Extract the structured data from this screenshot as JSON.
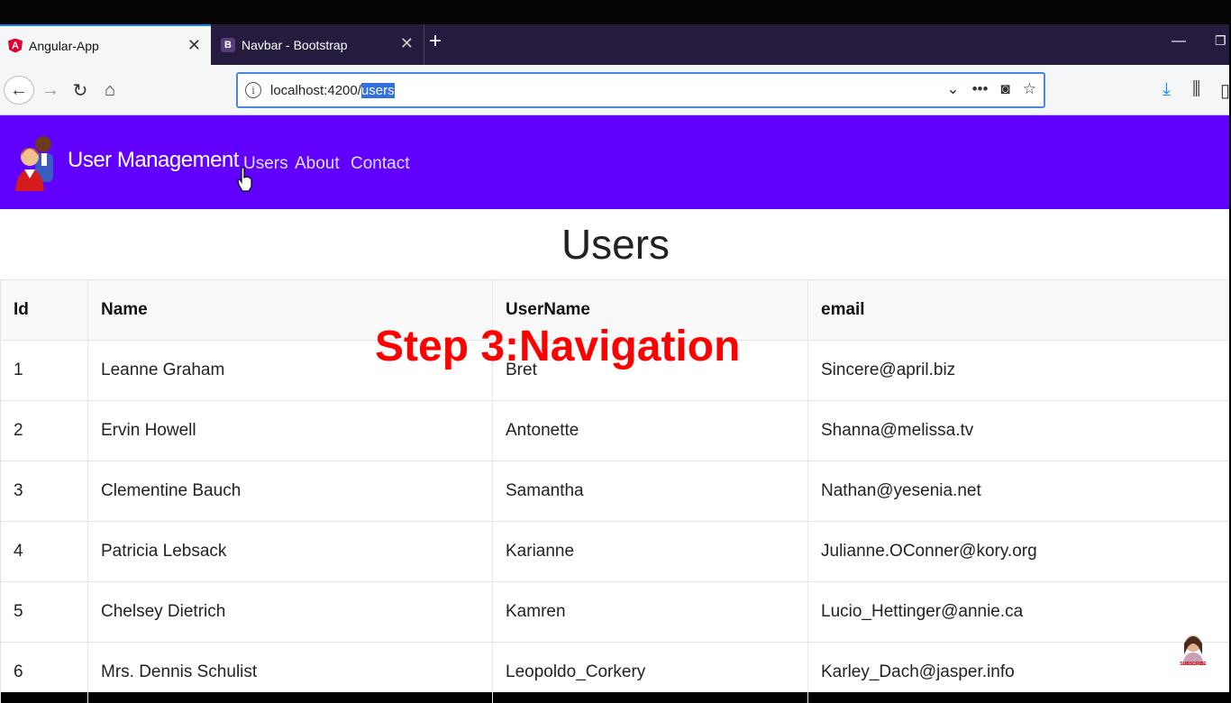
{
  "browser": {
    "tabs": [
      {
        "title": "Angular-App",
        "favicon": "angular-icon",
        "active": true
      },
      {
        "title": "Navbar - Bootstrap",
        "favicon": "bootstrap-icon",
        "active": false
      }
    ],
    "url_host": "localhost:4200/",
    "url_path": "users"
  },
  "app": {
    "brand": "User Management",
    "nav": [
      "Users",
      "About",
      "Contact"
    ],
    "colors": {
      "navbar": "#6200ff",
      "overlay": "#ff0000"
    }
  },
  "page": {
    "title": "Users",
    "columns": [
      "Id",
      "Name",
      "UserName",
      "email"
    ],
    "rows": [
      [
        "1",
        "Leanne Graham",
        "Bret",
        "Sincere@april.biz"
      ],
      [
        "2",
        "Ervin Howell",
        "Antonette",
        "Shanna@melissa.tv"
      ],
      [
        "3",
        "Clementine Bauch",
        "Samantha",
        "Nathan@yesenia.net"
      ],
      [
        "4",
        "Patricia Lebsack",
        "Karianne",
        "Julianne.OConner@kory.org"
      ],
      [
        "5",
        "Chelsey Dietrich",
        "Kamren",
        "Lucio_Hettinger@annie.ca"
      ],
      [
        "6",
        "Mrs. Dennis Schulist",
        "Leopoldo_Corkery",
        "Karley_Dach@jasper.info"
      ]
    ]
  },
  "overlay": {
    "text": "Step 3:Navigation"
  },
  "watermark": {
    "text": "SUBSCRIBE"
  }
}
